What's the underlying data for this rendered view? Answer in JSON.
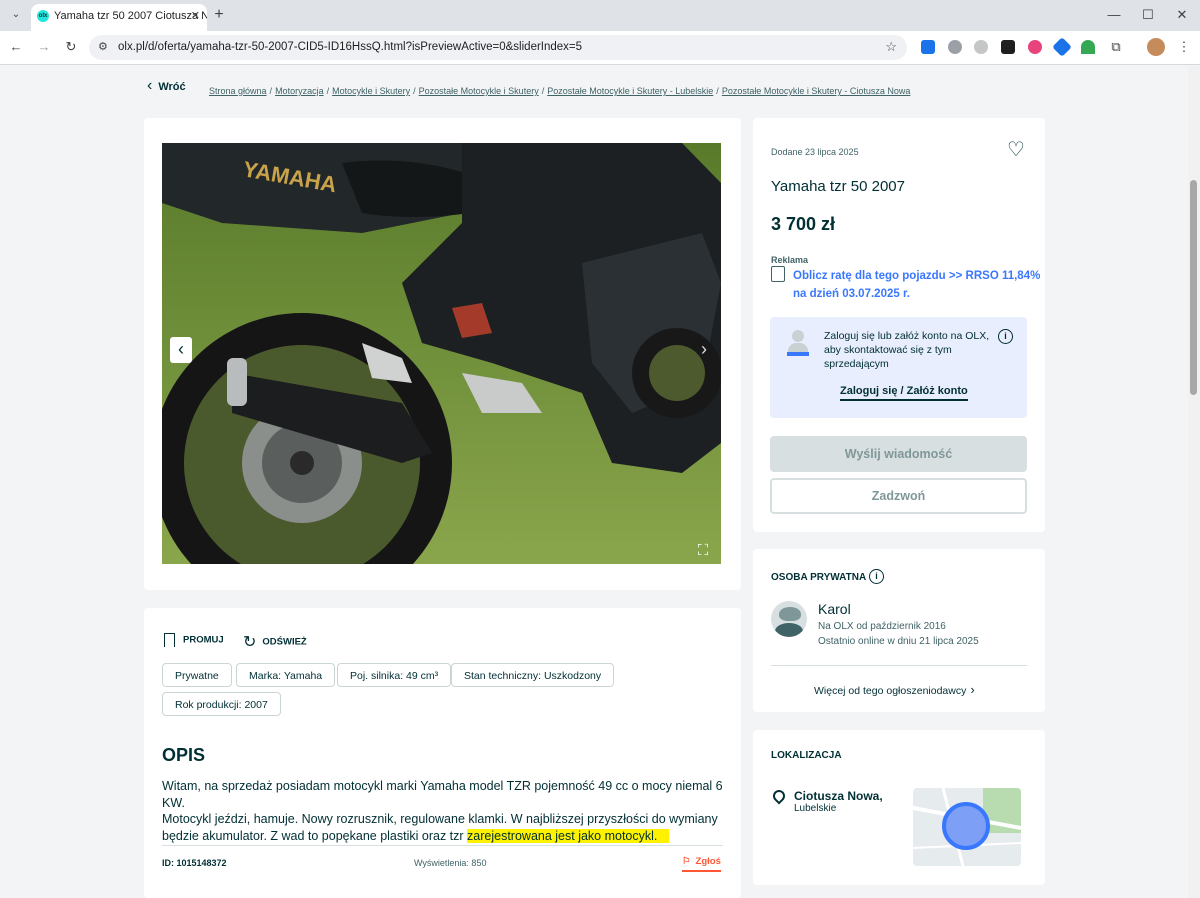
{
  "browser": {
    "tab_title": "Yamaha tzr 50 2007 Ciotusza N",
    "favicon_text": "olx",
    "url": "olx.pl/d/oferta/yamaha-tzr-50-2007-CID5-ID16HssQ.html?isPreviewActive=0&sliderIndex=5",
    "icons": [
      "tab-list-icon",
      "new-tab-icon",
      "minimize-icon",
      "maximize-icon",
      "close-icon",
      "back-icon",
      "forward-icon",
      "reload-icon",
      "site-info-icon",
      "star-icon",
      "extensions-icon",
      "profile-avatar"
    ]
  },
  "nav": {
    "back_label": "Wróć",
    "breadcrumbs": [
      "Strona główna",
      "Motoryzacja",
      "Motocykle i Skutery",
      "Pozostałe Motocykle i Skutery",
      "Pozostałe Motocykle i Skutery - Lubelskie",
      "Pozostałe Motocykle i Skutery - Ciotusza Nowa"
    ]
  },
  "gallery": {
    "brand_on_tank": "YAMAHA"
  },
  "listing": {
    "added": "Dodane 23 lipca 2025",
    "title": "Yamaha tzr 50 2007",
    "price": "3 700 zł",
    "ad_label": "Reklama",
    "ad_link_line1": "Oblicz ratę dla tego pojazdu >> RRSO 11,84%",
    "ad_link_line2": "na dzień 03.07.2025 r.",
    "login_prompt_line1": "Zaloguj się lub załóż konto na OLX,",
    "login_prompt_line2": "aby skontaktować się z tym",
    "login_prompt_line3": "sprzedającym",
    "login_link": "Zaloguj się / Załóż konto",
    "send_message": "Wyślij wiadomość",
    "call": "Zadzwoń"
  },
  "actions": {
    "promote": "PROMUJ",
    "refresh": "ODŚWIEŻ"
  },
  "params": [
    "Prywatne",
    "Marka: Yamaha",
    "Poj. silnika: 49 cm³",
    "Stan techniczny: Uszkodzony",
    "Rok produkcji: 2007"
  ],
  "description": {
    "heading": "OPIS",
    "line1": "Witam, na sprzedaż posiadam motocykl marki Yamaha model TZR pojemność 49 cc o mocy niemal 6 KW.",
    "line2": "Motocykl jeździ, hamuje. Nowy rozrusznik, regulowane klamki. W najbliższej przyszłości do wymiany",
    "line3_plain": "będzie akumulator. Z wad to popękane plastiki oraz tzr ",
    "line3_highlight": "zarejestrowana jest jako motocykl."
  },
  "footer_meta": {
    "id": "ID: 1015148372",
    "views": "Wyświetlenia: 850",
    "report": "Zgłoś"
  },
  "seller": {
    "section_title": "OSOBA PRYWATNA",
    "name": "Karol",
    "since": "Na OLX od październik 2016",
    "last_online": "Ostatnio online w dniu 21 lipca 2025",
    "more_ads": "Więcej od tego ogłoszeniodawcy"
  },
  "location": {
    "section_title": "LOKALIZACJA",
    "city": "Ciotusza Nowa,",
    "region": "Lubelskie"
  },
  "colors": {
    "primary": "#002f34",
    "link_blue": "#3a77ff",
    "highlight": "#fff200",
    "report_red": "#ff5636",
    "login_box": "#e8eefe"
  }
}
